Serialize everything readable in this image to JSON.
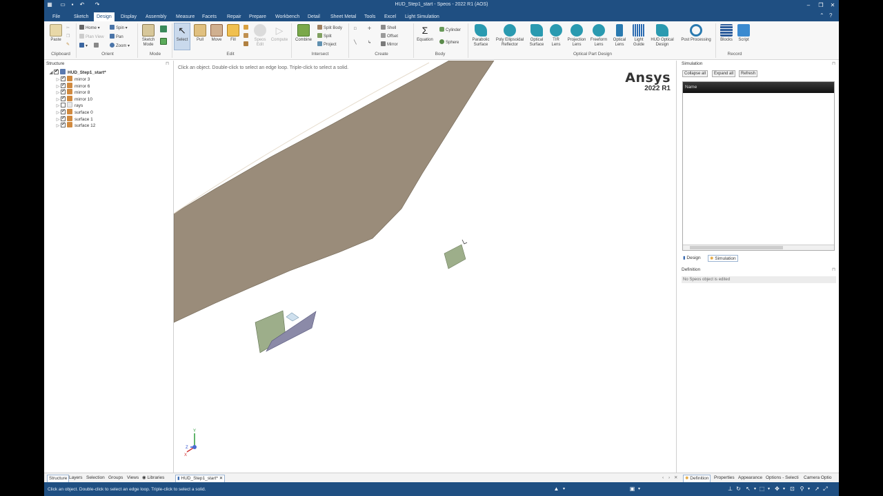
{
  "window": {
    "title": "HUD_Step1_start - Speos - 2022 R1 (AOS)"
  },
  "ribbon_tabs": [
    "File",
    "Sketch",
    "Design",
    "Display",
    "Assembly",
    "Measure",
    "Facets",
    "Repair",
    "Prepare",
    "Workbench",
    "Detail",
    "Sheet Metal",
    "Tools",
    "Excel",
    "Light Simulation"
  ],
  "active_tab": "Design",
  "ribbon": {
    "clipboard": {
      "paste": "Paste",
      "group": "Clipboard"
    },
    "orient": {
      "home": "Home",
      "spin": "Spin",
      "plan_view": "Plan View",
      "pan": "Pan",
      "zoom": "Zoom",
      "group": "Orient"
    },
    "mode": {
      "sketch_mode": "Sketch Mode",
      "group": "Mode"
    },
    "edit": {
      "select": "Select",
      "pull": "Pull",
      "move": "Move",
      "fill": "Fill",
      "group": "Edit"
    },
    "speos": {
      "speos_edit": "Speos Edit",
      "compute": "Compute"
    },
    "intersect": {
      "combine": "Combine",
      "split_body": "Split Body",
      "split": "Split",
      "project": "Project",
      "group": "Intersect"
    },
    "create": {
      "shell": "Shell",
      "offset": "Offset",
      "mirror": "Mirror",
      "group": "Create"
    },
    "body": {
      "equation": "Equation",
      "cylinder": "Cylinder",
      "sphere": "Sphere",
      "group": "Body"
    },
    "optical": {
      "items": [
        "Parabolic Surface",
        "Poly Ellipsoidal Reflector",
        "Optical Surface",
        "TIR Lens",
        "Projection Lens",
        "Freeform Lens",
        "Optical Lens",
        "Light Guide",
        "HUD Optical Design"
      ],
      "group": "Optical Part Design"
    },
    "post": {
      "post_processing": "Post Processing"
    },
    "record": {
      "blocks": "Blocks",
      "script": "Script",
      "group": "Record"
    }
  },
  "structure": {
    "title": "Structure",
    "root": "HUD_Step1_start*",
    "items": [
      {
        "label": "mirror 3",
        "checked": true
      },
      {
        "label": "mirror 6",
        "checked": true
      },
      {
        "label": "mirror 8",
        "checked": true
      },
      {
        "label": "mirror 10",
        "checked": true
      },
      {
        "label": "rays",
        "checked": false
      },
      {
        "label": "surface 0",
        "checked": true
      },
      {
        "label": "surface 1",
        "checked": true
      },
      {
        "label": "surface 12",
        "checked": true
      }
    ]
  },
  "viewport": {
    "hint": "Click an object. Double-click to select an edge loop. Triple-click to select a solid.",
    "brand": "Ansys",
    "version": "2022 R1",
    "triad": {
      "x": "X",
      "y": "Y",
      "z": "Z"
    }
  },
  "simulation": {
    "title": "Simulation",
    "collapse_all": "Collapse all",
    "expand_all": "Expand all",
    "refresh": "Refresh",
    "column_name": "Name",
    "tab_design": "Design",
    "tab_simulation": "Simulation",
    "definition_title": "Definition",
    "definition_msg": "No Speos object is edited"
  },
  "bottom_tabs_left": [
    "Structure",
    "Layers",
    "Selection",
    "Groups",
    "Views",
    "Libraries"
  ],
  "document_tab": "HUD_Step1_start*",
  "bottom_tabs_right": [
    "Definition",
    "Properties",
    "Appearance",
    "Options - Selecti",
    "Camera Optio"
  ],
  "status": {
    "message": "Click an object. Double-click to select an edge loop. Triple-click to select a solid."
  },
  "colors": {
    "brand_blue": "#1f4f82",
    "surface_brown": "#9a8c7a",
    "mirror_green": "#9dae8a",
    "mirror_purple": "#8b8aa8"
  }
}
